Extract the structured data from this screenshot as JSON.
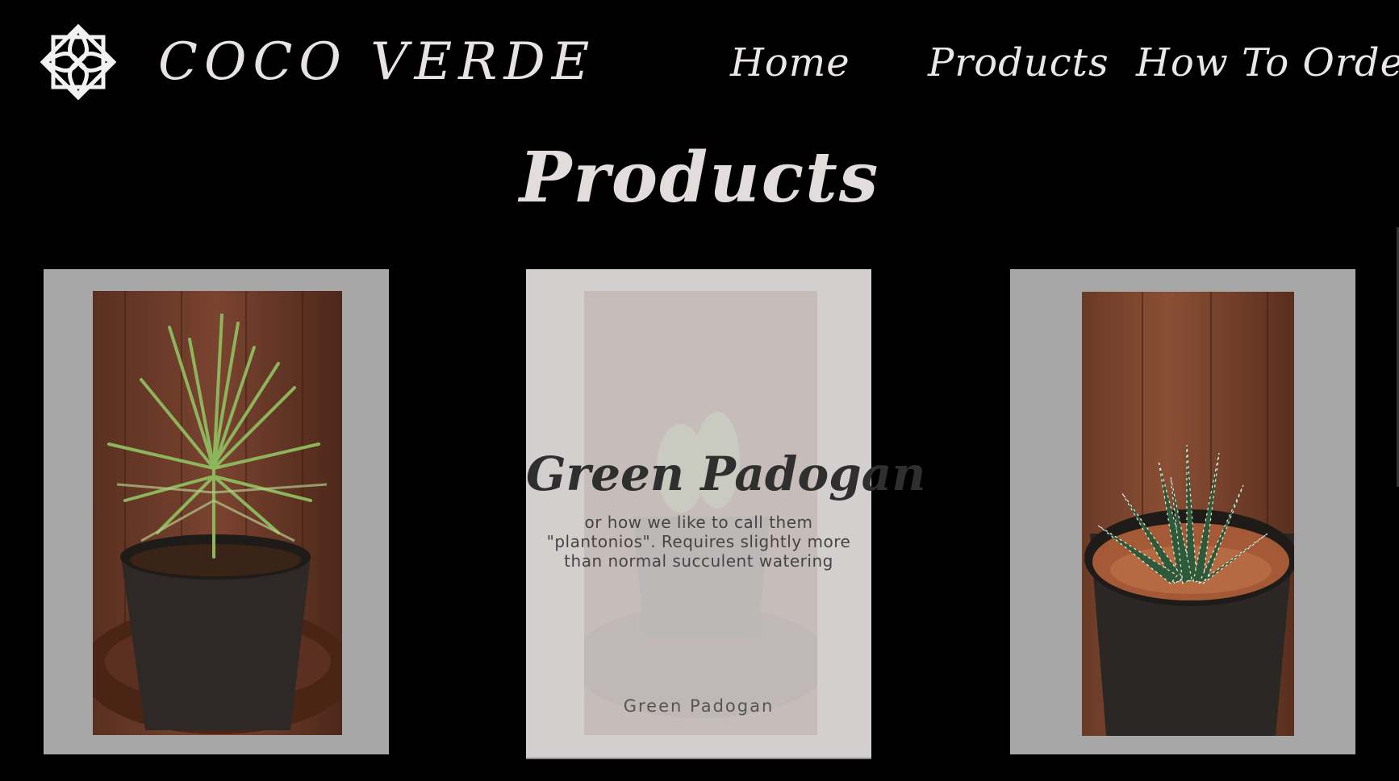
{
  "header": {
    "logo_icon": "mandala-logo-icon",
    "brand": "COCO VERDE",
    "nav": [
      {
        "label": "Home"
      },
      {
        "label": "Products"
      },
      {
        "label": "How To Order"
      }
    ]
  },
  "main": {
    "title": "Products",
    "products": [
      {
        "image": "pencil-succulent-in-black-pot"
      },
      {
        "image": "green-padogan-in-black-pot",
        "overlay_title": "Green Padogan",
        "overlay_description": "or how we like to call them \"plantonios\". Requires slightly more than normal succulent watering",
        "caption": "Green Padogan"
      },
      {
        "image": "zebra-haworthia-in-black-pot"
      }
    ]
  },
  "colors": {
    "background": "#000000",
    "text_light": "#ece7e7",
    "card_gray": "#a7a7a7",
    "card_hover": "#d3cfcf",
    "wood": "#6b3a24"
  }
}
